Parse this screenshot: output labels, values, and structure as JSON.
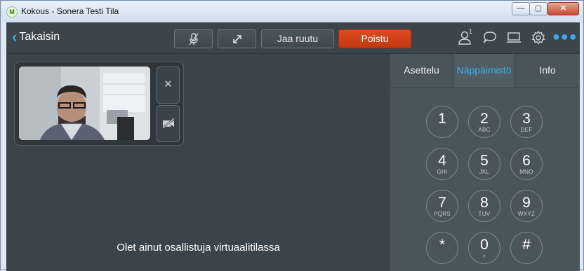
{
  "window": {
    "title": "Kokous - Sonera Testi Tila",
    "app_icon_letter": "M",
    "controls": {
      "minimize": "—",
      "maximize": "▢",
      "close": "✕"
    }
  },
  "toolbar": {
    "back_label": "Takaisin",
    "share_label": "Jaa ruutu",
    "leave_label": "Poistu",
    "participant_count": "1",
    "icons": [
      "mic-icon",
      "expand-icon",
      "people-icon",
      "chat-icon",
      "screen-icon",
      "gear-icon",
      "more-icon"
    ],
    "accent_color": "#3da8e8",
    "leave_color": "#d0401a"
  },
  "video": {
    "status_text": "Olet ainut osallistuja virtuaalitilassa"
  },
  "side_panel": {
    "tabs": [
      {
        "label": "Asettelu",
        "active": false
      },
      {
        "label": "Näppäimistö",
        "active": true
      },
      {
        "label": "Info",
        "active": false
      }
    ],
    "keypad": [
      {
        "digit": "1",
        "letters": ""
      },
      {
        "digit": "2",
        "letters": "ABC"
      },
      {
        "digit": "3",
        "letters": "DEF"
      },
      {
        "digit": "4",
        "letters": "GHI"
      },
      {
        "digit": "5",
        "letters": "JKL"
      },
      {
        "digit": "6",
        "letters": "MNO"
      },
      {
        "digit": "7",
        "letters": "PQRS"
      },
      {
        "digit": "8",
        "letters": "TUV"
      },
      {
        "digit": "9",
        "letters": "WXYZ"
      },
      {
        "digit": "*",
        "letters": ""
      },
      {
        "digit": "0",
        "letters": "+"
      },
      {
        "digit": "#",
        "letters": ""
      }
    ]
  }
}
